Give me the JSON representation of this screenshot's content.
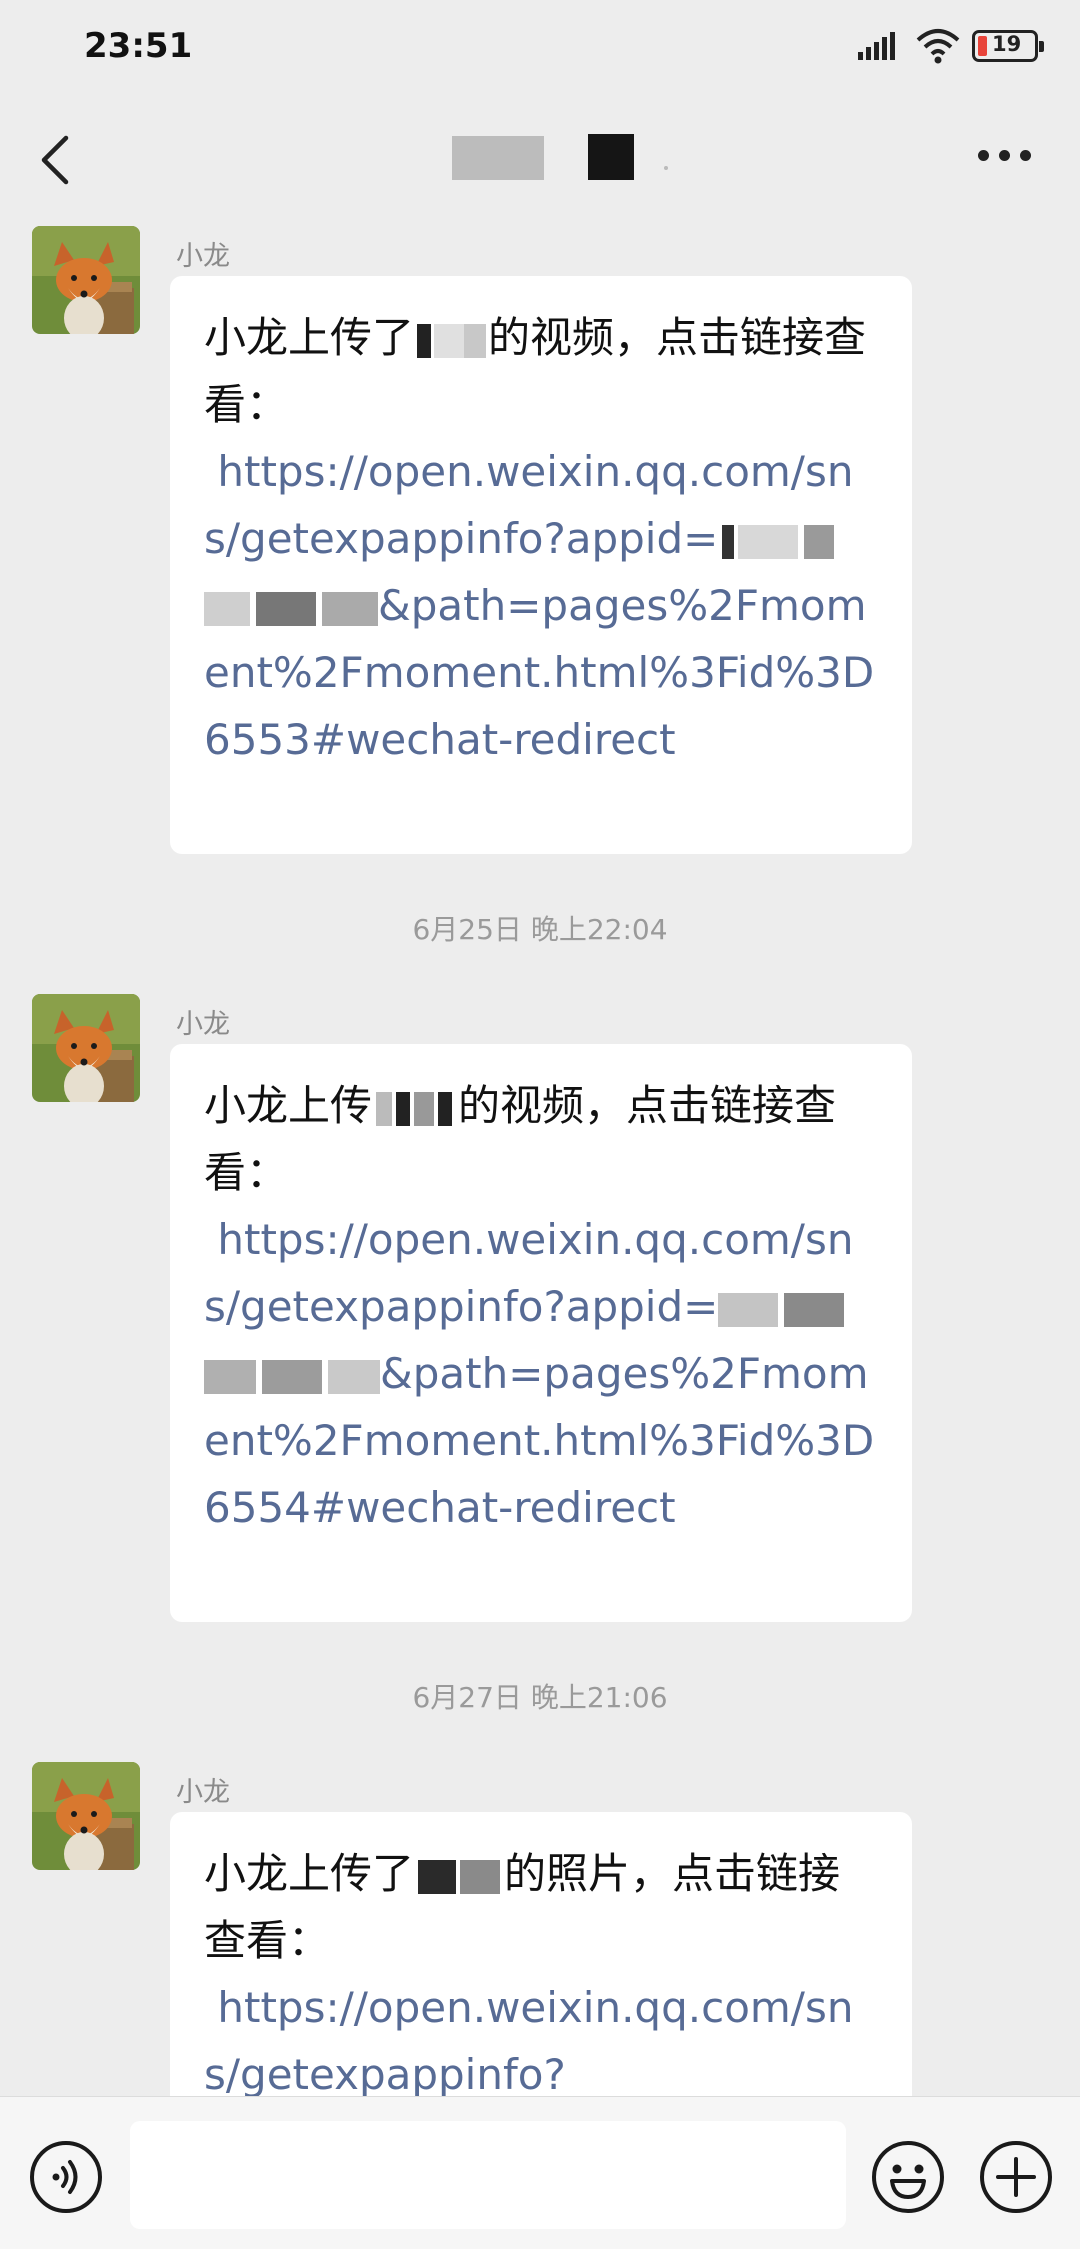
{
  "status_bar": {
    "time": "23:51",
    "battery": "19"
  },
  "nav": {
    "back_icon": "chevron-left-icon",
    "more_icon": "ellipsis-icon"
  },
  "messages": [
    {
      "sender": "小龙",
      "text_prefix": "小龙上传了",
      "text_suffix": "的视频，点击链接查看：",
      "link_start": " https://open.weixin.qq.com/sns/getexpappinfo?appid=",
      "link_end": "&path=pages%2Fmoment%2Fmoment.html%3Fid%3D6553#wechat-redirect"
    },
    {
      "sender": "小龙",
      "text_prefix": "小龙上传",
      "text_suffix": "的视频，点击链接查看：",
      "link_start": " https://open.weixin.qq.com/sns/getexpappinfo?appid=",
      "link_end": "&path=pages%2Fmoment%2Fmoment.html%3Fid%3D6554#wechat-redirect"
    },
    {
      "sender": "小龙",
      "text_prefix": "小龙上传了",
      "text_suffix": "的照片，点击链接查看：",
      "link_start": " https://open.weixin.qq.com/sns/getexpappinfo?",
      "link_end": ""
    }
  ],
  "timestamps": [
    "6月25日 晚上22:04",
    "6月27日 晚上21:06"
  ],
  "input_bar": {
    "input_value": "",
    "voice_icon": "voice-icon",
    "emoji_icon": "emoji-icon",
    "plus_icon": "plus-icon"
  },
  "colors": {
    "background": "#ededed",
    "link": "#576b95",
    "bubble": "#ffffff",
    "meta_text": "#8a8a8a"
  }
}
